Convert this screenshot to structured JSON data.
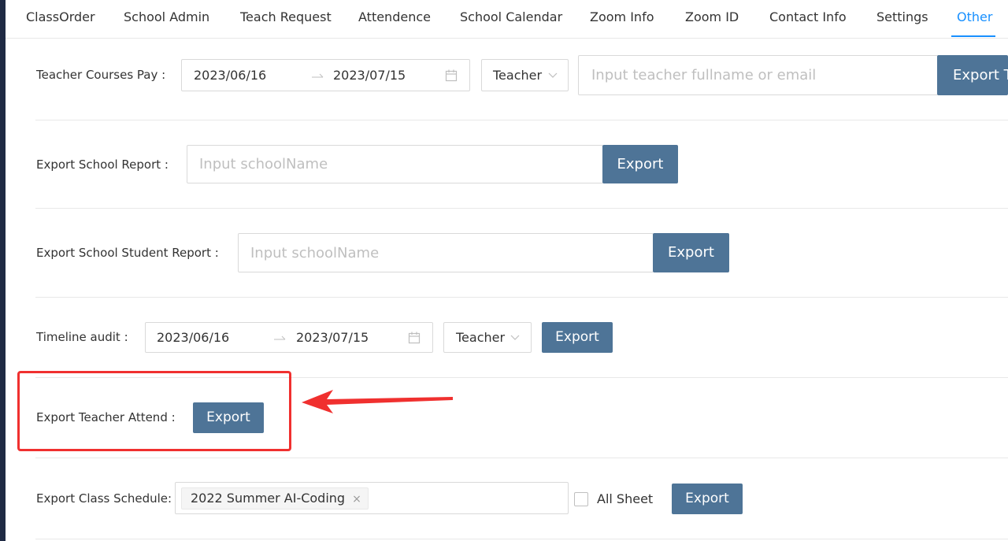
{
  "tabs": [
    {
      "label": "ClassOrder",
      "active": false
    },
    {
      "label": "School Admin",
      "active": false
    },
    {
      "label": "Teach Request",
      "active": false
    },
    {
      "label": "Attendence",
      "active": false
    },
    {
      "label": "School Calendar",
      "active": false
    },
    {
      "label": "Zoom Info",
      "active": false
    },
    {
      "label": "Zoom ID",
      "active": false
    },
    {
      "label": "Contact Info",
      "active": false
    },
    {
      "label": "Settings",
      "active": false
    },
    {
      "label": "Other",
      "active": true
    }
  ],
  "teacher_courses_pay": {
    "label": "Teacher Courses Pay :",
    "start_date": "2023/06/16",
    "end_date": "2023/07/15",
    "select_value": "Teacher",
    "search_placeholder": "Input teacher fullname or email",
    "button_label": "Export T"
  },
  "school_report": {
    "label": "Export School Report :",
    "placeholder": "Input schoolName",
    "button_label": "Export"
  },
  "school_student_report": {
    "label": "Export School Student Report :",
    "placeholder": "Input schoolName",
    "button_label": "Export"
  },
  "timeline_audit": {
    "label": "Timeline audit :",
    "start_date": "2023/06/16",
    "end_date": "2023/07/15",
    "select_value": "Teacher",
    "button_label": "Export"
  },
  "teacher_attend": {
    "label": "Export Teacher Attend :",
    "button_label": "Export"
  },
  "class_schedule": {
    "label": "Export Class Schedule:",
    "tag": "2022 Summer AI-Coding",
    "tag_close": "×",
    "checkbox_label": "All Sheet",
    "checkbox_checked": false,
    "button_label": "Export"
  },
  "colors": {
    "button": "#4e7497",
    "active_tab": "#1890ff",
    "annotation": "#f0302f"
  }
}
